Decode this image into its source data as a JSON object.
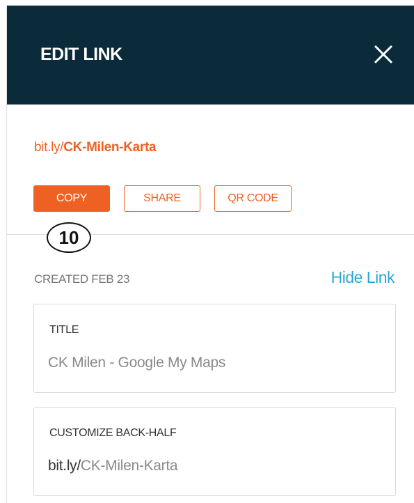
{
  "header": {
    "title": "EDIT LINK",
    "close_icon": "close-icon"
  },
  "link": {
    "prefix": "bit.ly/",
    "back_half": "CK-Milen-Karta"
  },
  "actions": {
    "copy_label": "COPY",
    "share_label": "SHARE",
    "qr_label": "QR CODE"
  },
  "step_marker": "10",
  "meta": {
    "created": "CREATED FEB 23",
    "hide_link": "Hide Link"
  },
  "fields": {
    "title": {
      "label": "TITLE",
      "value": "CK Milen - Google My Maps"
    },
    "back_half": {
      "label": "CUSTOMIZE BACK-HALF",
      "prefix": "bit.ly/",
      "value": "CK-Milen-Karta"
    }
  },
  "colors": {
    "header_bg": "#0b2a3a",
    "accent": "#ee6123",
    "link_blue": "#2aa7d6"
  }
}
